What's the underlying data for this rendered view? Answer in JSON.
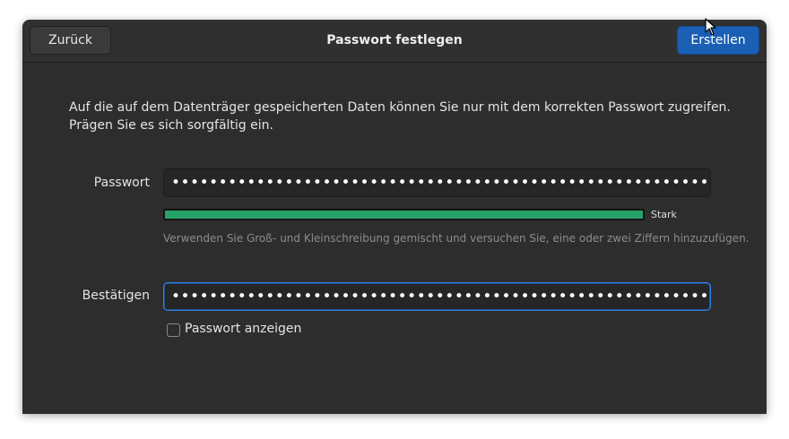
{
  "header": {
    "back_label": "Zurück",
    "title": "Passwort festlegen",
    "create_label": "Erstellen"
  },
  "description": "Auf die auf dem Datenträger gespeicherten Daten können Sie nur mit dem korrekten Passwort zugreifen. Prägen Sie es sich sorgfältig ein.",
  "password": {
    "label": "Passwort",
    "value": "•••••••••••••••••••••••••••••••••••••••••••••••••••••••••••••••"
  },
  "strength": {
    "label": "Stark",
    "level": 1.0,
    "color": "#26a269",
    "hint": "Verwenden Sie Groß- und Kleinschreibung gemischt und versuchen Sie, eine oder zwei Ziffern hinzuzufügen."
  },
  "confirm": {
    "label": "Bestätigen",
    "value": "••••••••••••••••••••••••••••••••••••••••••••••••••••••••••••••••"
  },
  "show_password": {
    "label": "Passwort anzeigen",
    "checked": false
  },
  "colors": {
    "accent": "#1b5fb4",
    "focus": "#3584e4",
    "background": "#2d2d2d"
  }
}
